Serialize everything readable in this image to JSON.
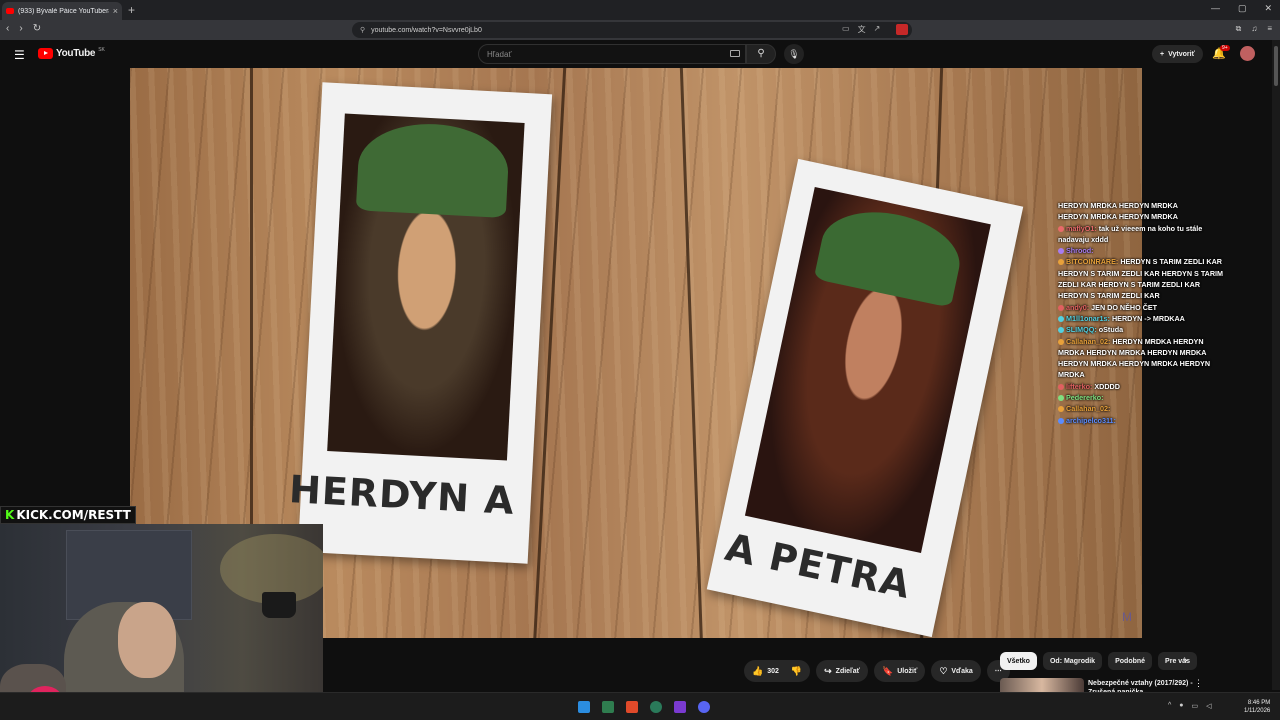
{
  "browser": {
    "tab_title": "(933) Bývalé Páice YouTubera",
    "url": "youtube.com/watch?v=Nsvvre0jLb0"
  },
  "youtube": {
    "logo_text": "YouTube",
    "country_code": "SK",
    "search_placeholder": "Hľadať",
    "create_label": "Vytvoriť",
    "notification_count": "9+"
  },
  "video": {
    "caption_left": "HERDYN A",
    "caption_right": "A PETRA"
  },
  "chat": [
    {
      "user": "",
      "user_color": "#ffffff",
      "text": "HERDYN MRDKA HERDYN MRDKA"
    },
    {
      "user": "",
      "user_color": "#ffffff",
      "text": "HERDYN MRDKA HERDYN MRDKA"
    },
    {
      "user": "maflyO1:",
      "user_color": "#e86a6a",
      "text": "tak už vieeem na koho tu stále nadavaju xddd"
    },
    {
      "user": "Shrood:",
      "user_color": "#a77cf0",
      "text": ""
    },
    {
      "user": "BITCOINRARE:",
      "user_color": "#e8a13a",
      "text": "HERDYN S TARIM ZEDLI KAR HERDYN S TARIM ZEDLI KAR HERDYN S TARIM ZEDLI KAR HERDYN S TARIM ZEDLI KAR HERDYN S TARIM ZEDLI KAR"
    },
    {
      "user": "andy0:",
      "user_color": "#e06060",
      "text": "JEN DO NĚHO ČET"
    },
    {
      "user": "M1ll1onar1s:",
      "user_color": "#53d0e0",
      "text": "HERDYN -> MRDKAA"
    },
    {
      "user": "SLIMQQ:",
      "user_color": "#53d0e0",
      "text": "oStuda"
    },
    {
      "user": "Callahan_02:",
      "user_color": "#e8a13a",
      "text": "HERDYN MRDKA HERDYN MRDKA HERDYN MRDKA HERDYN MRDKA HERDYN MRDKA HERDYN MRDKA HERDYN MRDKA"
    },
    {
      "user": "lifterko:",
      "user_color": "#e06060",
      "text": "XDDDD"
    },
    {
      "user": "Pedererko:",
      "user_color": "#7fe07f",
      "text": ""
    },
    {
      "user": "Callahan_02:",
      "user_color": "#e8a13a",
      "text": ""
    },
    {
      "user": "archipelco311:",
      "user_color": "#5a8cff",
      "text": ""
    }
  ],
  "stream": {
    "kick_logo_text": "KICK.COM/RESTT"
  },
  "actions": {
    "like_count": "302",
    "share_label": "Zdieľať",
    "save_label": "Uložiť",
    "thanks_label": "Vďaka"
  },
  "chips": [
    {
      "label": "Všetko",
      "active": true
    },
    {
      "label": "Od: Magrodik",
      "active": false
    },
    {
      "label": "Podobné",
      "active": false
    },
    {
      "label": "Pre vás",
      "active": false
    }
  ],
  "suggestion": {
    "title": "Nebezpečné vztahy (2017/292) - Zrušená panička"
  },
  "taskbar": {
    "time": "8:46 PM",
    "date": "1/11/2026"
  },
  "colors": {
    "youtube_red": "#ff0000",
    "kick_green": "#53fc18",
    "background": "#0f0f0f"
  }
}
